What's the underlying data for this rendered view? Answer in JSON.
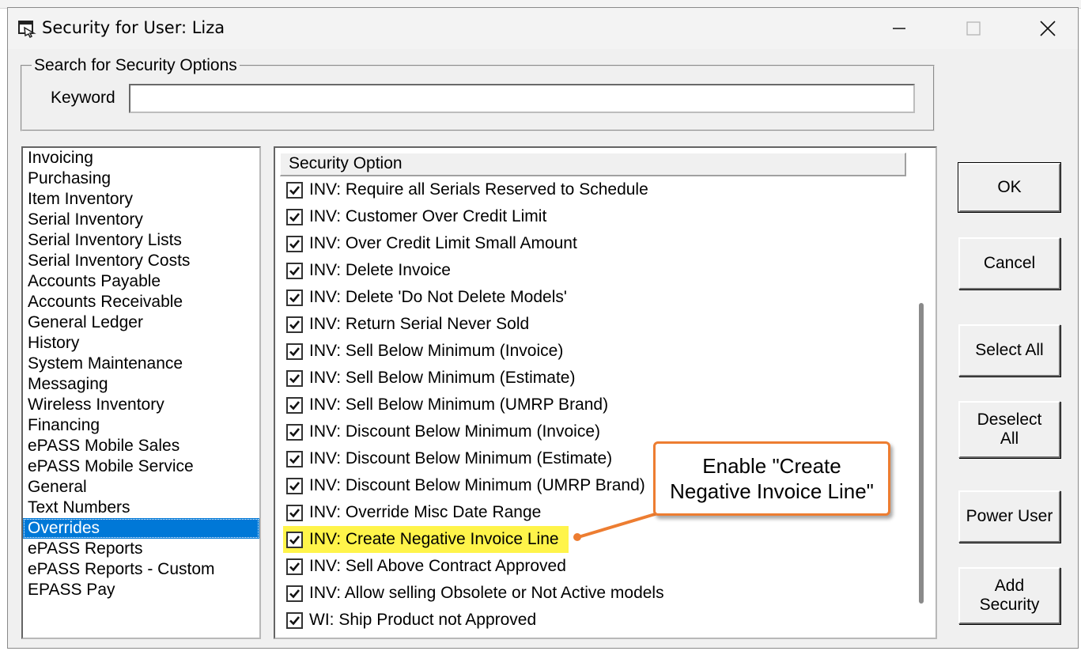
{
  "window": {
    "title": "Security for User: Liza",
    "icon": "security-app-icon",
    "controls": [
      "minimize",
      "maximize",
      "close"
    ]
  },
  "search": {
    "group_label": "Search for Security Options",
    "keyword_label": "Keyword",
    "keyword_value": "",
    "keyword_placeholder": ""
  },
  "categories": {
    "items": [
      "Invoicing",
      "Purchasing",
      "Item Inventory",
      "Serial Inventory",
      "Serial Inventory Lists",
      "Serial Inventory Costs",
      "Accounts Payable",
      "Accounts Receivable",
      "General Ledger",
      "History",
      "System Maintenance",
      "Messaging",
      "Wireless Inventory",
      "Financing",
      "ePASS Mobile Sales",
      "ePASS Mobile Service",
      "General",
      "Text Numbers",
      "Overrides",
      "ePASS Reports",
      "ePASS Reports - Custom",
      "EPASS Pay"
    ],
    "selected": "Overrides"
  },
  "options": {
    "column_header": "Security Option",
    "rows": [
      {
        "label": "INV: Require all Serials Reserved to Schedule",
        "checked": true
      },
      {
        "label": "INV: Customer Over Credit Limit",
        "checked": true
      },
      {
        "label": "INV: Over Credit Limit Small Amount",
        "checked": true
      },
      {
        "label": "INV: Delete Invoice",
        "checked": true
      },
      {
        "label": "INV: Delete 'Do Not Delete Models'",
        "checked": true
      },
      {
        "label": "INV: Return Serial Never Sold",
        "checked": true
      },
      {
        "label": "INV: Sell Below Minimum (Invoice)",
        "checked": true
      },
      {
        "label": "INV: Sell Below Minimum (Estimate)",
        "checked": true
      },
      {
        "label": "INV: Sell Below Minimum (UMRP Brand)",
        "checked": true
      },
      {
        "label": "INV: Discount Below Minimum (Invoice)",
        "checked": true
      },
      {
        "label": "INV: Discount Below Minimum (Estimate)",
        "checked": true
      },
      {
        "label": "INV: Discount Below Minimum (UMRP Brand)",
        "checked": true
      },
      {
        "label": "INV: Override Misc Date Range",
        "checked": true
      },
      {
        "label": "INV: Create Negative Invoice Line",
        "checked": true,
        "highlighted": true
      },
      {
        "label": "INV: Sell Above Contract Approved",
        "checked": true
      },
      {
        "label": "INV: Allow selling Obsolete or Not Active models",
        "checked": true
      },
      {
        "label": "WI: Ship Product not Approved",
        "checked": true
      }
    ]
  },
  "buttons": {
    "ok": "OK",
    "cancel": "Cancel",
    "select_all": "Select All",
    "deselect_all": "Deselect\nAll",
    "power_user": "Power User",
    "add_security": "Add\nSecurity"
  },
  "callout": {
    "text": "Enable \"Create Negative Invoice Line\"",
    "border_color": "#ed7d31"
  },
  "colors": {
    "selection": "#0078d7",
    "highlight": "#fff44a",
    "dialog_bg": "#f0f0f0"
  }
}
